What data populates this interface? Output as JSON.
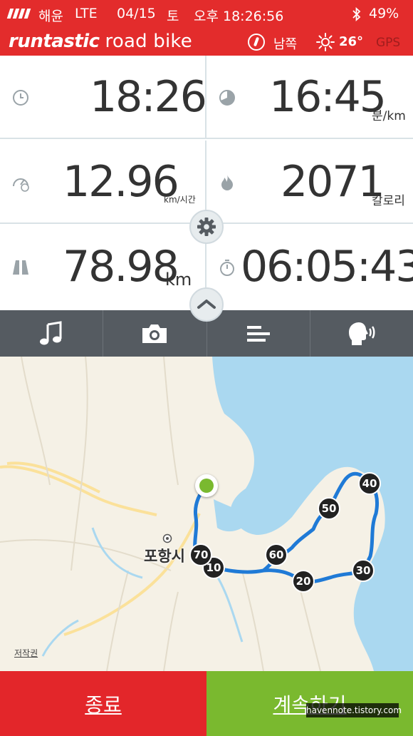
{
  "status_bar": {
    "carrier": "해윤",
    "network": "LTE",
    "date": "04/15",
    "weekday": "토",
    "time": "오후 18:26:56",
    "battery": "49%"
  },
  "header": {
    "brand_primary": "runtastic",
    "brand_secondary": "road bike",
    "direction": "남쪽",
    "temperature": "26°",
    "gps_label": "GPS"
  },
  "stats": {
    "time_of_day": {
      "value": "18:26",
      "icon": "clock-icon"
    },
    "pace": {
      "value": "16:45",
      "unit": "분/km",
      "icon": "pace-icon"
    },
    "speed": {
      "value": "12.96",
      "unit": "km/시간",
      "icon": "speedometer-icon"
    },
    "calories": {
      "value": "2071",
      "unit": "칼로리",
      "icon": "flame-icon"
    },
    "distance": {
      "value": "78.98",
      "unit": "km",
      "icon": "road-icon"
    },
    "duration": {
      "value": "06:05:43",
      "icon": "stopwatch-icon"
    }
  },
  "toolbar": [
    "music-icon",
    "camera-icon",
    "split-table-icon",
    "voice-coach-icon"
  ],
  "map": {
    "city_label": "포항시",
    "credit": "저작권",
    "km_markers": [
      "10",
      "20",
      "30",
      "40",
      "50",
      "60",
      "70"
    ]
  },
  "buttons": {
    "stop_label": "종료",
    "continue_label": "계속하기"
  },
  "watermark": "havennote.tistory.com",
  "colors": {
    "brand_red": "#e32c2c",
    "continue_green": "#7ab92f",
    "route_blue": "#1f7ad6",
    "toolbar_gray": "#555b61"
  }
}
